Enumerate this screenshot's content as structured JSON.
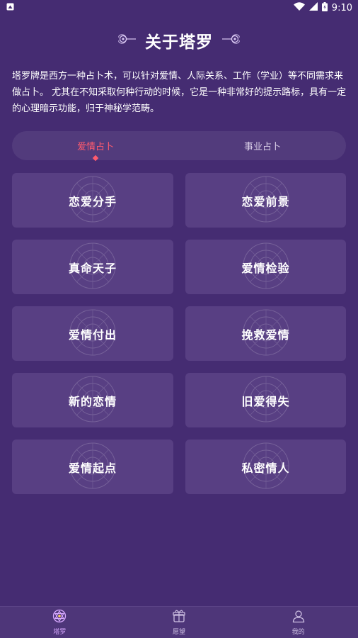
{
  "status_bar": {
    "time": "9:10"
  },
  "header": {
    "title": "关于塔罗"
  },
  "intro": {
    "text": "塔罗牌是西方一种占卜术，可以针对爱情、人际关系、工作（学业）等不同需求来做占卜。 尤其在不知采取何种行动的时候，它是一种非常好的提示路标，具有一定的心理暗示功能，归于神秘学范畴。"
  },
  "tabs": [
    {
      "label": "爱情占卜",
      "active": true
    },
    {
      "label": "事业占卜",
      "active": false
    }
  ],
  "cards": [
    {
      "label": "恋爱分手"
    },
    {
      "label": "恋爱前景"
    },
    {
      "label": "真命天子"
    },
    {
      "label": "爱情检验"
    },
    {
      "label": "爱情付出"
    },
    {
      "label": "挽救爱情"
    },
    {
      "label": "新的恋情"
    },
    {
      "label": "旧爱得失"
    },
    {
      "label": "爱情起点"
    },
    {
      "label": "私密情人"
    }
  ],
  "bottom_nav": [
    {
      "label": "塔罗",
      "icon": "tarot-star-icon",
      "active": true
    },
    {
      "label": "愿望",
      "icon": "gift-box-icon",
      "active": false
    },
    {
      "label": "我的",
      "icon": "user-profile-icon",
      "active": false
    }
  ],
  "colors": {
    "background": "#452c72",
    "card": "#583f83",
    "accent": "#ff5b6e",
    "nav_active": "#d8a9ff"
  }
}
